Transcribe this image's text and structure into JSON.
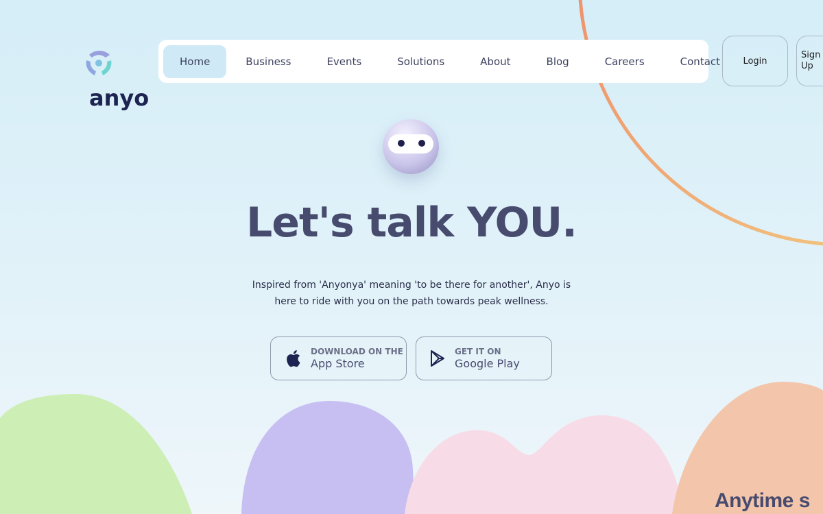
{
  "brand": {
    "name": "anyo"
  },
  "nav": {
    "items": [
      {
        "label": "Home",
        "active": true
      },
      {
        "label": "Business"
      },
      {
        "label": "Events"
      },
      {
        "label": "Solutions"
      },
      {
        "label": "About"
      },
      {
        "label": "Blog"
      },
      {
        "label": "Careers"
      },
      {
        "label": "Contact"
      }
    ]
  },
  "auth": {
    "login": "Login",
    "signup": "Sign Up"
  },
  "hero": {
    "title": "Let's talk YOU.",
    "subtitle": "Inspired from 'Anyonya' meaning 'to be there for another', Anyo is here to ride with you on the path towards peak wellness."
  },
  "stores": {
    "apple": {
      "small": "DOWNLOAD ON THE",
      "big": "App Store",
      "icon": "apple-icon"
    },
    "google": {
      "small": "GET IT ON",
      "big": "Google Play",
      "icon": "play-icon"
    }
  },
  "bottom": {
    "heading": "Anytime s"
  },
  "colors": {
    "nav_active": "#cfeaf6",
    "text": "#474b6e",
    "green": "#cdeeb4",
    "purple": "#c7bff2",
    "pink": "#f7dbe6",
    "peach": "#f3c5aa"
  }
}
